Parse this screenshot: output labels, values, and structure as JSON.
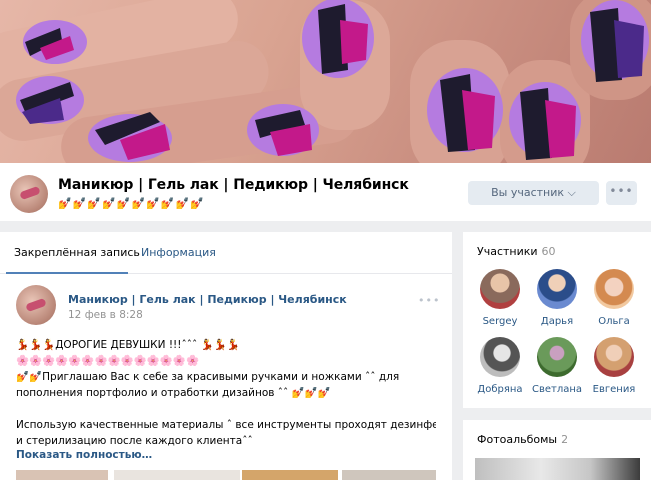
{
  "group": {
    "title": "Маникюр | Гель лак | Педикюр | Челябинск",
    "status": "💅💅💅💅💅💅💅💅💅💅",
    "member_button": "Вы участник ⌵",
    "more_button": "•••"
  },
  "tabs": [
    {
      "label": "Закреплённая запись",
      "active": true
    },
    {
      "label": "Информация",
      "active": false
    }
  ],
  "post": {
    "author": "Маникюр | Гель лак | Педикюр | Челябинск",
    "date": "12 фев в 8:28",
    "more": "•••",
    "lines": [
      "💃💃💃ДОРОГИЕ ДЕВУШКИ !!!ˆˆˆ 💃💃💃",
      "🌸🌸🌸🌸🌸🌸🌸🌸🌸🌸🌸🌸🌸🌸",
      "💅💅Приглашаю Вас к себе за красивыми ручками и ножками ˆˆ для",
      "пополнения портфолио и отработки дизайнов ˆˆ 💅💅💅",
      "",
      "Использую качественные материалы ˆ все инструменты проходят дезинфекцию",
      "и стерилизацию после каждого клиентаˆˆ"
    ],
    "show_more": "Показать полностью…"
  },
  "members": {
    "title": "Участники",
    "count": "60",
    "people": [
      {
        "name": "Sergey",
        "color": "#8a6a5c"
      },
      {
        "name": "Дарья",
        "color": "#4a6fa8"
      },
      {
        "name": "Ольга",
        "color": "#e0a878"
      },
      {
        "name": "Добряна",
        "color": "#3a3a3a"
      },
      {
        "name": "Светлана",
        "color": "#6a8a5a"
      },
      {
        "name": "Евгения",
        "color": "#c89070"
      }
    ]
  },
  "albums": {
    "title": "Фотоальбомы",
    "count": "2"
  },
  "colors": {
    "link": "#2a5885",
    "accent": "#5181b8",
    "background": "#edeef0"
  }
}
